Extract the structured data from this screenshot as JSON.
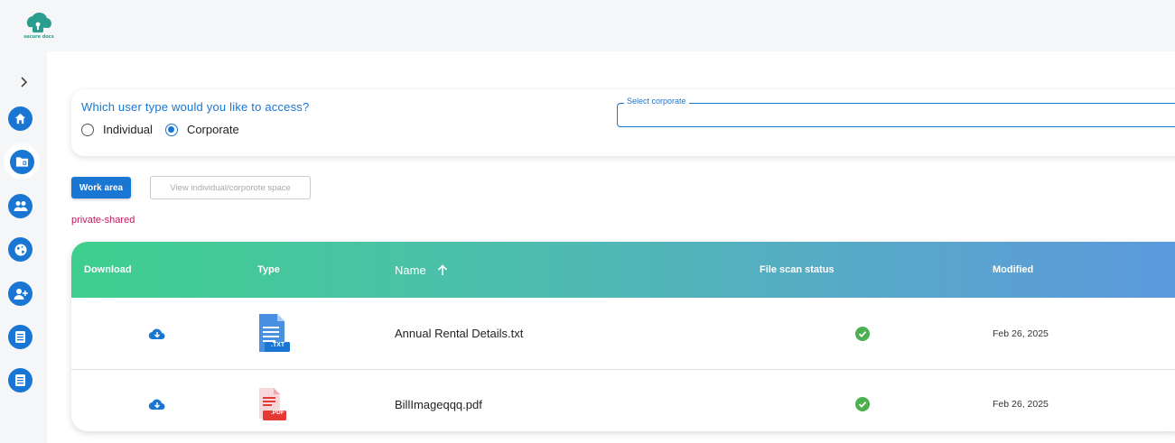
{
  "app": {
    "logo_text": "secure docs",
    "brand_color": "#2a9d8f",
    "accent_color": "#1976d2"
  },
  "sidebar": {
    "toggle_icon": "chevron-right-icon",
    "items": [
      {
        "icon": "home-icon"
      },
      {
        "icon": "folder-icon",
        "active": true
      },
      {
        "icon": "users-group-icon"
      },
      {
        "icon": "globe-icon"
      },
      {
        "icon": "add-user-icon"
      },
      {
        "icon": "document-list-icon"
      },
      {
        "icon": "document-list-icon"
      }
    ]
  },
  "access": {
    "question": "Which user type would you like to access?",
    "options": [
      {
        "label": "Individual",
        "selected": false
      },
      {
        "label": "Corporate",
        "selected": true
      }
    ],
    "corporate_select_label": "Select corporate",
    "corporate_select_value": ""
  },
  "toolbar": {
    "work_area_label": "Work area",
    "view_space_label": "View individual/corporote space"
  },
  "space_label": "private-shared",
  "table": {
    "columns": {
      "download": "Download",
      "type": "Type",
      "name": "Name",
      "scan": "File scan status",
      "modified": "Modified"
    },
    "sort": {
      "column": "name",
      "direction": "ascending"
    },
    "rows": [
      {
        "type": "TXT",
        "type_badge": ".TXT",
        "name": "Annual Rental Details.txt",
        "scan_status": "clean",
        "modified": "Feb 26, 2025"
      },
      {
        "type": "PDF",
        "type_badge": ".PDF",
        "name": "BillImageqqq.pdf",
        "scan_status": "clean",
        "modified": "Feb 26, 2025"
      }
    ]
  }
}
